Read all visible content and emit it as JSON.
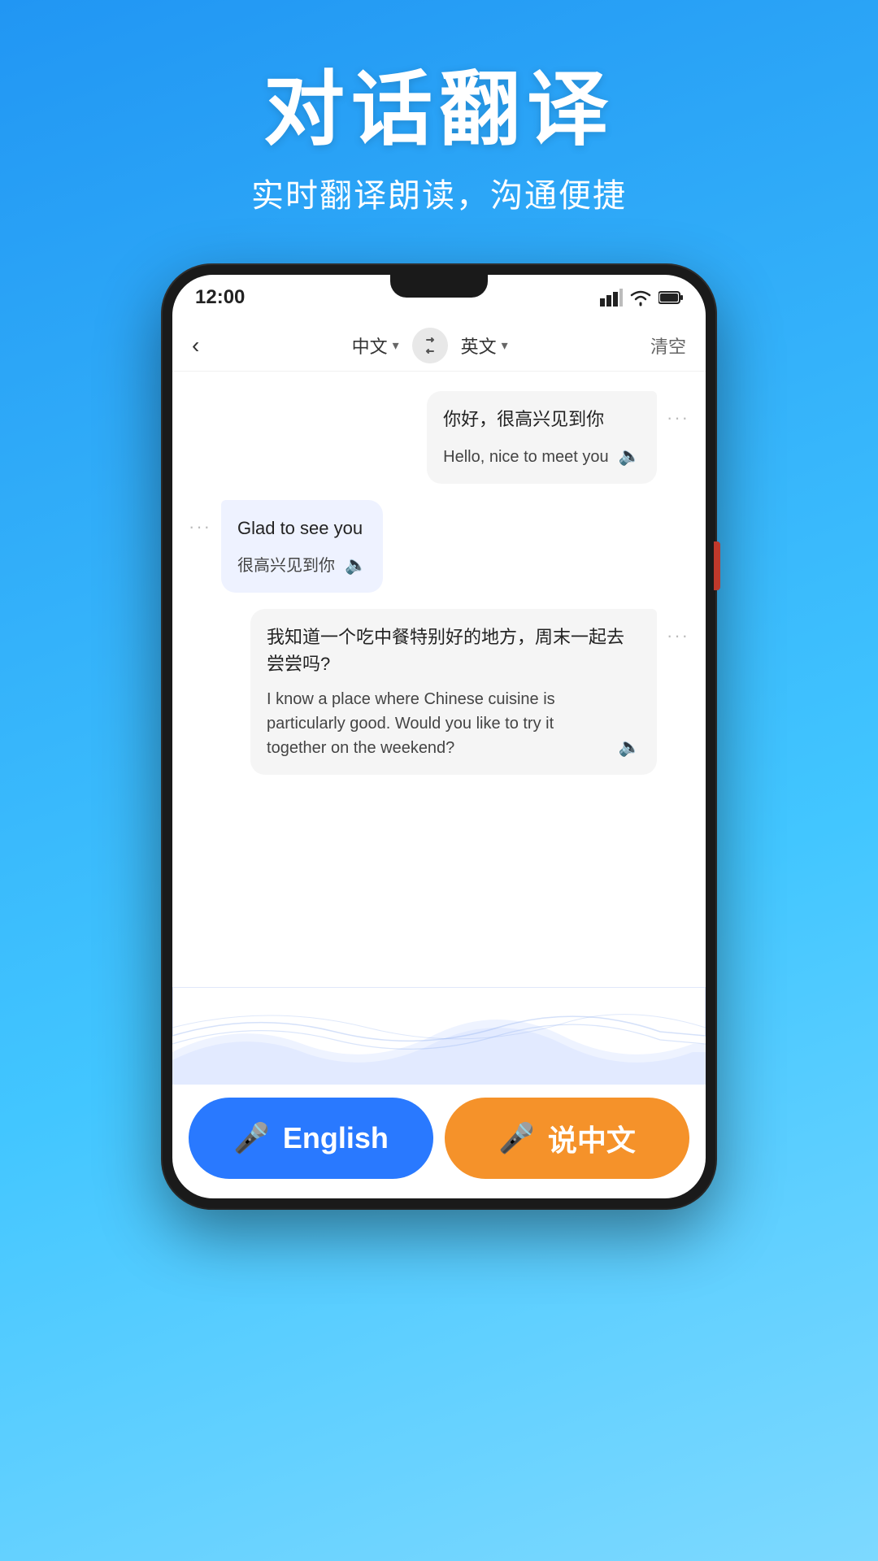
{
  "header": {
    "main_title": "对话翻译",
    "sub_title": "实时翻译朗读，沟通便捷"
  },
  "phone": {
    "status": {
      "time": "12:00"
    },
    "nav": {
      "back_label": "‹",
      "lang_left": "中文",
      "lang_right": "英文",
      "clear": "清空",
      "swap": "⇄"
    },
    "messages": [
      {
        "id": 1,
        "align": "right",
        "original": "你好，很高兴见到你",
        "translated": "Hello, nice to meet you"
      },
      {
        "id": 2,
        "align": "left",
        "original": "Glad to see you",
        "translated": "很高兴见到你"
      },
      {
        "id": 3,
        "align": "right",
        "original": "我知道一个吃中餐特别好的地方，周末一起去尝尝吗?",
        "translated": "I know a place where Chinese cuisine is particularly good. Would you like to try it together on the weekend?"
      }
    ]
  },
  "bottom_buttons": {
    "english_label": "English",
    "chinese_label": "说中文",
    "mic_icon": "🎤"
  }
}
